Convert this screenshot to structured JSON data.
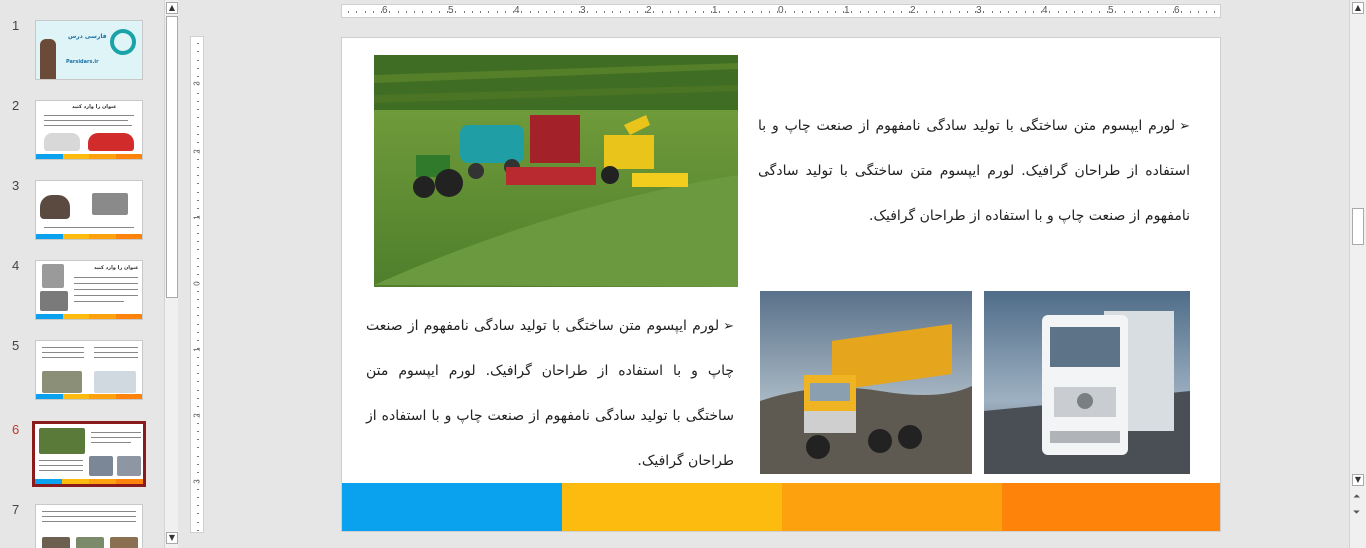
{
  "thumbnails": [
    {
      "num": "1",
      "title": "فارسی درس",
      "caption": "Parsidars.ir",
      "active": false
    },
    {
      "num": "2",
      "title": "عنوان را وارد کنید",
      "active": false
    },
    {
      "num": "3",
      "active": false
    },
    {
      "num": "4",
      "title": "عنوان را وارد کنید",
      "active": false
    },
    {
      "num": "5",
      "active": false
    },
    {
      "num": "6",
      "active": true
    },
    {
      "num": "7",
      "active": false
    }
  ],
  "ruler": {
    "horizontal": [
      "6",
      "5",
      "4",
      "3",
      "2",
      "1",
      "0",
      "1",
      "2",
      "3",
      "4",
      "5",
      "6"
    ],
    "vertical": [
      "3",
      "2",
      "1",
      "0",
      "1",
      "2",
      "3"
    ]
  },
  "slide": {
    "text_top": "لورم ایپسوم متن ساختگی با تولید سادگی نامفهوم از صنعت چاپ و با استفاده از طراحان گرافیک. لورم ایپسوم متن ساختگی با تولید سادگی نامفهوم از صنعت چاپ و با استفاده از طراحان گرافیک.",
    "text_bottom": "لورم ایپسوم متن ساختگی با تولید سادگی نامفهوم از صنعت چاپ و با استفاده از طراحان گرافیک. لورم ایپسوم متن ساختگی با تولید سادگی نامفهوم از صنعت چاپ و با استفاده از طراحان گرافیک.",
    "bullet_symbol": "➢",
    "bar_colors": [
      "#0aa2ee",
      "#fdbb0f",
      "#fda10e",
      "#fd830a"
    ]
  },
  "icons": {
    "thumb_scroll_up": "▲",
    "thumb_scroll_down": "▼",
    "main_scroll_up": "▲",
    "main_scroll_down": "▼",
    "prev_slide": "⏶",
    "next_slide": "⏷"
  }
}
